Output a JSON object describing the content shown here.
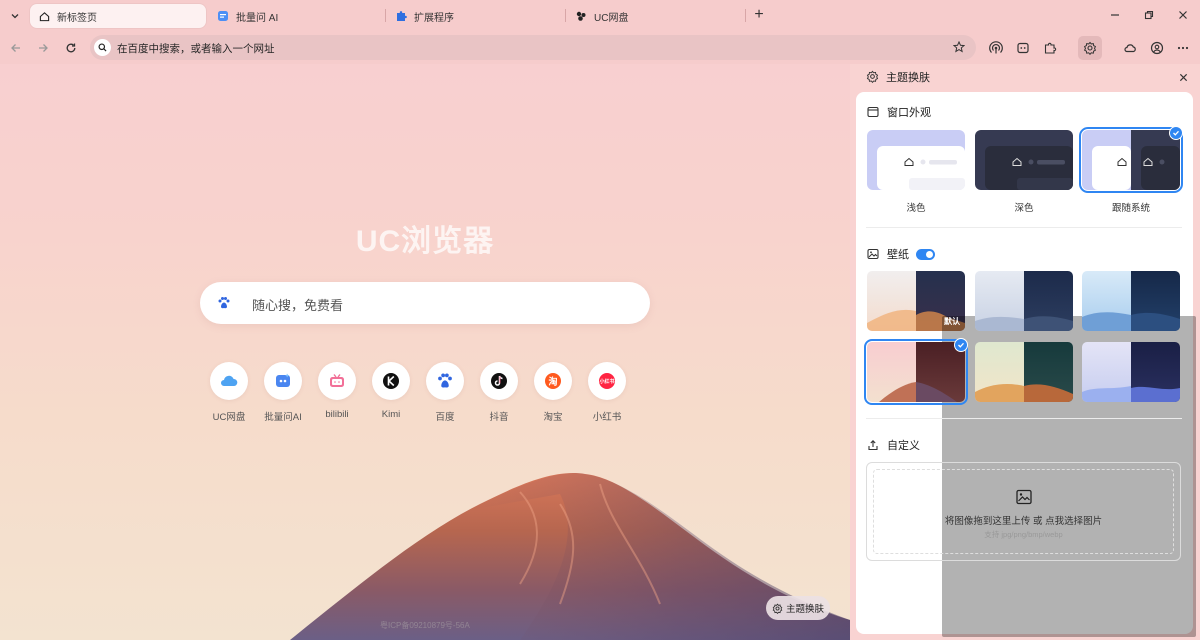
{
  "tabs": [
    {
      "label": "新标签页",
      "icon": "home-icon",
      "active": true
    },
    {
      "label": "批量问 AI",
      "icon": "batch-ai-icon",
      "active": false
    },
    {
      "label": "扩展程序",
      "icon": "puzzle-icon",
      "active": false
    },
    {
      "label": "UC网盘",
      "icon": "uc-drive-icon",
      "active": false
    }
  ],
  "newtab": {
    "label": "+"
  },
  "toolbar": {
    "omnibox_text": "在百度中搜索，或者输入一个网址"
  },
  "content": {
    "logo": "UC浏览器",
    "search_placeholder": "随心搜，免费看",
    "quick_links": [
      {
        "label": "UC网盘",
        "icon": "uc-drive-icon"
      },
      {
        "label": "批量问AI",
        "icon": "batch-ai-icon"
      },
      {
        "label": "bilibili",
        "icon": "bilibili-icon"
      },
      {
        "label": "Kimi",
        "icon": "kimi-icon"
      },
      {
        "label": "百度",
        "icon": "baidu-icon"
      },
      {
        "label": "抖音",
        "icon": "douyin-icon"
      },
      {
        "label": "淘宝",
        "icon": "taobao-icon"
      },
      {
        "label": "小红书",
        "icon": "xiaohongshu-icon"
      }
    ],
    "theme_button": "主题换肤",
    "icp": "粤ICP备09210879号-56A"
  },
  "panel": {
    "title": "主题换肤",
    "appearance": {
      "title": "窗口外观",
      "options": [
        {
          "label": "浅色",
          "selected": false
        },
        {
          "label": "深色",
          "selected": false
        },
        {
          "label": "跟随系统",
          "selected": true
        }
      ]
    },
    "wallpaper": {
      "title": "壁纸",
      "enabled": true,
      "default_badge": "默认",
      "selected_index": 3
    },
    "custom": {
      "title": "自定义",
      "upload_text": "将图像拖到这里上传 或 点我选择图片",
      "upload_hint": "支持 jpg/png/bmp/webp"
    }
  },
  "colors": {
    "accent": "#2f86f2",
    "chrome_bg": "#f6cccc",
    "panel_bg": "#ffffff"
  }
}
